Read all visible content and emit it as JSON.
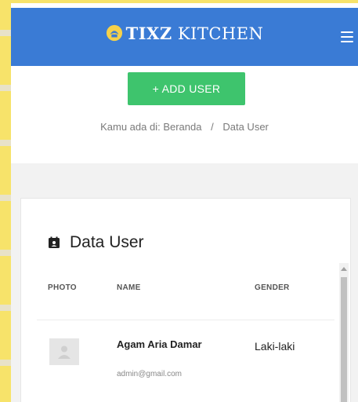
{
  "app": {
    "brand_bold": "TIXZ",
    "brand_rest": " KITCHEN"
  },
  "toolbar": {
    "add_user_label": "+ ADD USER"
  },
  "breadcrumb": {
    "prefix": "Kamu ada di:",
    "home": "Beranda",
    "separator": "/",
    "current": "Data User"
  },
  "card": {
    "title": "Data User"
  },
  "table": {
    "headers": [
      "PHOTO",
      "NAME",
      "GENDER"
    ],
    "rows": [
      {
        "name": "Agam Aria Damar",
        "email": "admin@gmail.com",
        "gender": "Laki-laki"
      }
    ]
  },
  "colors": {
    "topbar": "#3a7bd5",
    "add_button": "#3ec46d"
  },
  "icons": {
    "logo": "chef-logo-icon",
    "menu": "hamburger-menu-icon",
    "title": "calendar-user-icon",
    "avatar": "user-silhouette-icon"
  }
}
